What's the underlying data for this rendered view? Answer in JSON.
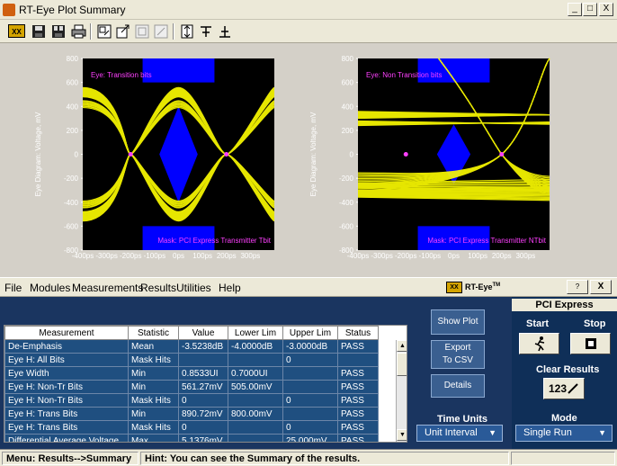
{
  "window": {
    "title": "RT-Eye Plot Summary",
    "minimize": "_",
    "restore": "□",
    "close": "X"
  },
  "toolbar": {
    "icons": [
      "rt-eye-logo-icon",
      "save-icon",
      "save-all-icon",
      "print-icon",
      "export-icon",
      "import-icon",
      "zoom-icon",
      "pan-icon",
      "cursor-icon",
      "marker-up-icon",
      "marker-down-icon"
    ]
  },
  "plots": [
    {
      "ylabel": "Eye Diagram: Voltage, mV",
      "eye_label": "Eye: Transition bits",
      "mask_label": "Mask: PCI Express Transmitter Tbit",
      "y_ticks": [
        "800",
        "600",
        "400",
        "200",
        "0",
        "-200",
        "-400",
        "-600",
        "-800"
      ],
      "x_ticks": [
        "-400ps",
        "-300ps",
        "-200ps",
        "-100ps",
        "0ps",
        "100ps",
        "200ps",
        "300ps"
      ]
    },
    {
      "ylabel": "Eye Diagram: Voltage, mV",
      "eye_label": "Eye: Non Transition bits",
      "mask_label": "Mask: PCI Express Transmitter NTbit",
      "y_ticks": [
        "800",
        "600",
        "400",
        "200",
        "0",
        "-200",
        "-400",
        "-600",
        "-800"
      ],
      "x_ticks": [
        "-400ps",
        "-300ps",
        "-200ps",
        "-100ps",
        "0ps",
        "100ps",
        "200ps",
        "300ps"
      ]
    }
  ],
  "menu": {
    "items": [
      "File",
      "Modules",
      "Measurements",
      "Results",
      "Utilities",
      "Help"
    ],
    "logo": "RT-Eye",
    "tm": "TM",
    "help_icon": "?",
    "close": "X"
  },
  "table": {
    "headers": [
      "Measurement",
      "Statistic",
      "Value",
      "Lower Lim",
      "Upper Lim",
      "Status"
    ],
    "rows": [
      [
        "De-Emphasis",
        "Mean",
        "-3.5238dB",
        "-4.0000dB",
        "-3.0000dB",
        "PASS"
      ],
      [
        "Eye H: All Bits",
        "Mask Hits",
        "",
        "",
        "0",
        ""
      ],
      [
        "Eye Width",
        "Min",
        "0.8533UI",
        "0.7000UI",
        "",
        "PASS"
      ],
      [
        "Eye H: Non-Tr Bits",
        "Min",
        "561.27mV",
        "505.00mV",
        "",
        "PASS"
      ],
      [
        "Eye H: Non-Tr Bits",
        "Mask Hits",
        "0",
        "",
        "0",
        "PASS"
      ],
      [
        "Eye H: Trans Bits",
        "Min",
        "890.72mV",
        "800.00mV",
        "",
        "PASS"
      ],
      [
        "Eye H: Trans Bits",
        "Mask Hits",
        "0",
        "",
        "0",
        "PASS"
      ],
      [
        "Differential Average Voltage",
        "Max",
        "5.1376mV",
        "",
        "25.000mV",
        "PASS"
      ]
    ]
  },
  "buttons": {
    "show_plot": "Show Plot",
    "export_line1": "Export",
    "export_line2": "To CSV",
    "details": "Details"
  },
  "time_units": {
    "label": "Time Units",
    "value": "Unit Interval"
  },
  "right_panel": {
    "title": "PCI Express",
    "start": "Start",
    "stop": "Stop",
    "clear_results": "Clear Results",
    "clear_icon_text": "123",
    "mode_label": "Mode",
    "mode_value": "Single Run"
  },
  "status": {
    "menu_path": "Menu: Results-->Summary",
    "hint": "Hint: You can see the Summary of the results."
  },
  "colors": {
    "eye_trace": "#ffff00",
    "mask": "#0000ff",
    "label": "#ff40ff",
    "panel_bg": "#1a3560"
  }
}
